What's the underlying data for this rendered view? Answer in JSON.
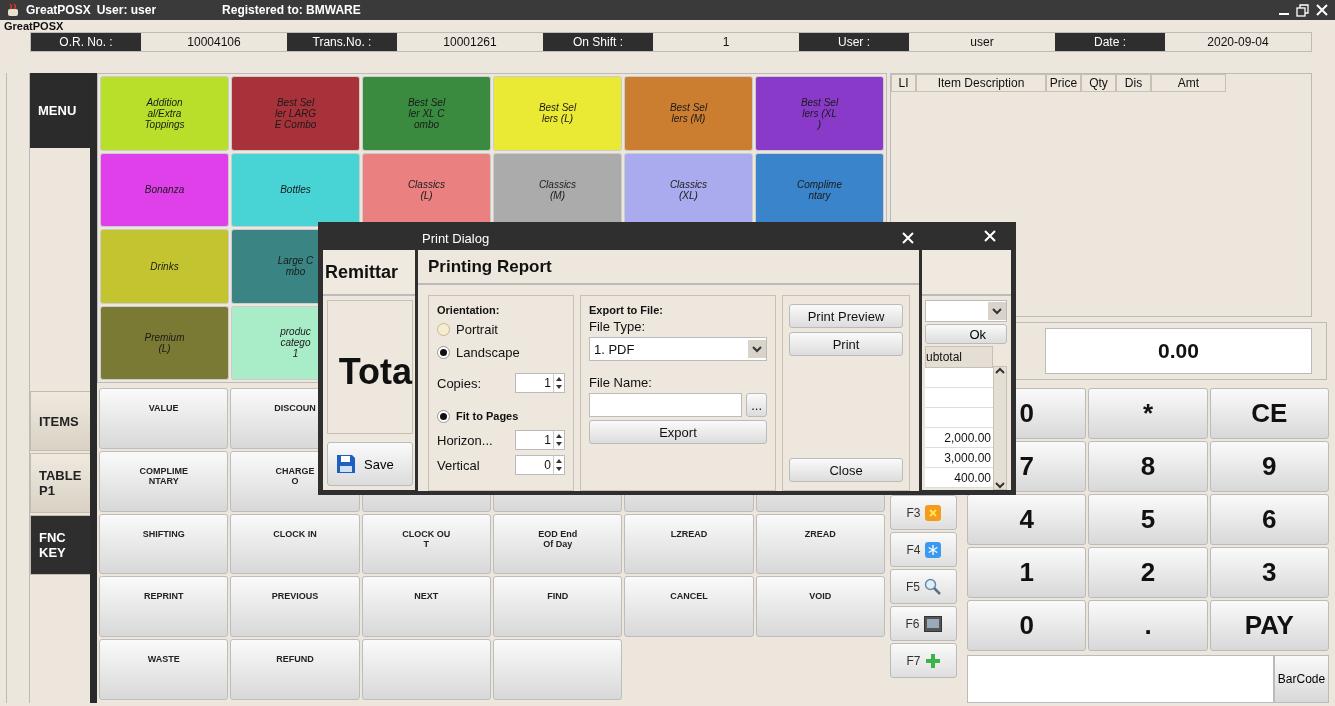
{
  "window": {
    "title": "GreatPOSX",
    "user": "User: user",
    "registered": "Registered to: BMWARE"
  },
  "group_label": "GreatPOSX",
  "info_bar": [
    {
      "label": "O.R. No. :",
      "value": "10004106"
    },
    {
      "label": "Trans.No. :",
      "value": "10001261"
    },
    {
      "label": "On Shift :",
      "value": "1"
    },
    {
      "label": "User :",
      "value": "user"
    },
    {
      "label": "Date :",
      "value": "2020-09-04"
    }
  ],
  "side_panel": {
    "menu_label": "MENU",
    "tabs": [
      {
        "label": "ITEMS",
        "selected": false
      },
      {
        "label": "TABLE\nP1",
        "selected": false
      },
      {
        "label": "FNC\nKEY",
        "selected": true
      }
    ]
  },
  "menu_rows": [
    [
      {
        "label": "Addition\nal/Extra\nToppings",
        "color": "#b8e02a"
      },
      {
        "label": "Best Sel\nler LARG\nE Combo",
        "color": "#a8323a"
      },
      {
        "label": "Best Sel\nler XL C\nombo",
        "color": "#3a8a40"
      },
      {
        "label": "Best Sel\nlers (L)",
        "color": "#eaea34"
      },
      {
        "label": "Best Sel\nlers (M)",
        "color": "#cc7e30"
      },
      {
        "label": "Best Sel\nlers (XL\n)",
        "color": "#8a3ac8"
      }
    ],
    [
      {
        "label": "Bonanza",
        "color": "#e040ea"
      },
      {
        "label": "Bottles",
        "color": "#48d4d4"
      },
      {
        "label": "Classics\n(L)",
        "color": "#ea8080"
      },
      {
        "label": "Classics\n(M)",
        "color": "#ababab"
      },
      {
        "label": "Classics\n(XL)",
        "color": "#aaaaee"
      },
      {
        "label": "Complime\nntary",
        "color": "#3a84cc"
      }
    ],
    [
      {
        "label": "Drinks",
        "color": "#c4c430"
      },
      {
        "label": "Large C\nmbo",
        "color": "#3a8484"
      }
    ],
    [
      {
        "label": "Premium\n(L)",
        "color": "#7a7a34"
      },
      {
        "label": "produc\ncatego\n1",
        "color": "#a8ecc8"
      }
    ]
  ],
  "function_rows": [
    [
      {
        "kind": "key",
        "label": "VALUE"
      },
      {
        "kind": "key",
        "label": "DISCOUN"
      }
    ],
    [
      {
        "kind": "key",
        "label": "COMPLIME\nNTARY"
      },
      {
        "kind": "key",
        "label": "CHARGE\nO"
      },
      {
        "kind": "blank"
      },
      {
        "kind": "blank"
      },
      {
        "kind": "blank"
      },
      {
        "kind": "blank"
      }
    ],
    [
      {
        "kind": "key",
        "label": "SHIFTING"
      },
      {
        "kind": "key",
        "label": "CLOCK IN"
      },
      {
        "kind": "key",
        "label": "CLOCK OU\nT"
      },
      {
        "kind": "key",
        "label": "EOD End\nOf Day"
      },
      {
        "kind": "key",
        "label": "LZREAD"
      },
      {
        "kind": "key",
        "label": "ZREAD"
      }
    ],
    [
      {
        "kind": "key",
        "label": "REPRINT"
      },
      {
        "kind": "key",
        "label": "PREVIOUS"
      },
      {
        "kind": "key",
        "label": "NEXT"
      },
      {
        "kind": "key",
        "label": "FIND"
      },
      {
        "kind": "key",
        "label": "CANCEL"
      },
      {
        "kind": "key",
        "label": "VOID"
      }
    ],
    [
      {
        "kind": "key",
        "label": "WASTE"
      },
      {
        "kind": "key",
        "label": "REFUND"
      },
      {
        "kind": "blank"
      },
      {
        "kind": "blank"
      }
    ]
  ],
  "item_table": {
    "columns": [
      "LI",
      "Item Description",
      "Price",
      "Qty",
      "Dis",
      "Amt"
    ]
  },
  "total_display": "0.00",
  "f_keys": [
    {
      "label": "F3",
      "kind": "cancel"
    },
    {
      "label": "F4",
      "kind": "snow"
    },
    {
      "label": "F5",
      "kind": "search"
    },
    {
      "label": "F6",
      "kind": "monitor"
    },
    {
      "label": "F7",
      "kind": "add"
    }
  ],
  "keypad": [
    "0",
    "*",
    "CE",
    "7",
    "8",
    "9",
    "4",
    "5",
    "6",
    "1",
    "2",
    "3",
    "0",
    ".",
    "PAY"
  ],
  "barcode_button": "BarCode",
  "remittance_dialog": {
    "header": "Remittar",
    "total_label": "Tota",
    "save_button": "Save",
    "ok_button": "Ok",
    "column": "ubtotal",
    "rows": [
      {
        "kind": "blank"
      },
      {
        "kind": "blank"
      },
      {
        "kind": "blank"
      },
      {
        "kind": "amount",
        "value": "2,000.00"
      },
      {
        "kind": "amount",
        "value": "3,000.00"
      },
      {
        "kind": "amount",
        "value": "400.00"
      }
    ]
  },
  "print_dialog": {
    "title": "Print Dialog",
    "header": "Printing Report",
    "orientation": {
      "label": "Orientation:",
      "options": [
        {
          "label": "Portrait",
          "selected": false
        },
        {
          "label": "Landscape",
          "selected": true
        }
      ]
    },
    "copies": {
      "label": "Copies:",
      "value": "1"
    },
    "fit_to_pages": {
      "label": "Fit to Pages",
      "selected": true
    },
    "horizontal": {
      "label": "Horizon...",
      "value": "1"
    },
    "vertical": {
      "label": "Vertical",
      "value": "0"
    },
    "export": {
      "heading": "Export to File:",
      "file_type_label": "File Type:",
      "file_type": "1. PDF",
      "file_name_label": "File Name:",
      "browse_button": "...",
      "export_button": "Export"
    },
    "buttons": [
      "Print Preview",
      "Print",
      "Close"
    ]
  }
}
